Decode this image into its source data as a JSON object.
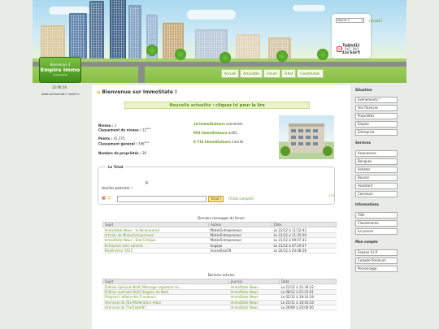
{
  "header": {
    "logo_line1": "Bienvenue à",
    "logo_line2": "Empire Immo",
    "logo_line3": "Indie Game",
    "nav": [
      "Accueil",
      "Actualités",
      "Forum",
      "Tchat",
      "Constitution"
    ],
    "world_select": "Monde 2",
    "avatar_alt": "[avatar]",
    "username": "Teddy911",
    "money": "414 648 €"
  },
  "clock": "12:06:14",
  "ad_slot": "data-ad-format=\"auto\">",
  "main": {
    "title": "Bienvenue sur ImmoState !",
    "news_label": "Nouvelle actualité",
    "news_action": " : cliquez ici pour la lire",
    "stats": {
      "niveau_label": "Niveau :",
      "niveau": "1",
      "classement_niveau_label": "Classement du niveau :",
      "classement_niveau": "12",
      "classement_niveau_sup": "ème",
      "points_label": "Points :",
      "points": "41 275",
      "classement_general_label": "Classement général :",
      "classement_general": "346",
      "classement_general_sup": "ème",
      "proprietes_label": "Nombre de propriétés :",
      "proprietes": "36"
    },
    "counts": [
      {
        "num": "14 ImmoStateurs",
        "text": " connectés"
      },
      {
        "num": "993 ImmoStateurs",
        "text": " actifs"
      },
      {
        "num": "8 716 ImmoStateurs",
        "text": " inscrits"
      }
    ],
    "tchat": {
      "title": "Le Tchat",
      "waiting": "Veuillez patienter !",
      "send": "Tchat !",
      "full": "[Tchat complet]",
      "expand": "[+]"
    },
    "forum": {
      "caption": "Derniers messages du forum",
      "headers": [
        "Sujet",
        "Auteur",
        "Date"
      ],
      "rows": [
        [
          "ImmoState News : la Renaissance",
          "MisterEntrepreneur",
          "Le 21/12 à 11:52:43"
        ],
        [
          "Articles de MisterEntrepreneur",
          "MisterEntrepreneur",
          "Le 21/12 à 11:35:59"
        ],
        [
          "ImmoState News : Etat Critique",
          "MisterEntrepreneur",
          "Le 21/12 à 09:57:33"
        ],
        [
          "Entreprise sans salariés",
          "Sugayo",
          "Le 21/12 à 07:19:57"
        ],
        [
          "Modérateur 2015",
          "marsellaix59",
          "Le 20/12 à 20:08:28"
        ]
      ]
    },
    "articles": {
      "caption": "Derniers articles",
      "headers": [
        "Sujet",
        "Journal",
        "Date"
      ],
      "rows": [
        [
          "[Edition Spéciale Noël] Message important du ...",
          "ImmoState News",
          "Le 21/12 à 11:34:12"
        ],
        [
          "[Edition spéciale Noël] Slogans de Noël",
          "ImmoState News",
          "Le 08/12 à 21:23:01"
        ],
        [
          "[People] L'affaire des Fraudeurs",
          "ImmoState News",
          "Le 02/12 à 18:14:16"
        ],
        [
          "Interview de l'Ex-Modérateur Adoo",
          "ImmoState News",
          "Le 25/11 à 16:43:24"
        ],
        [
          "Interview de TheTrader87",
          "ImmoState News",
          "Le 29/09 à 20:00:00"
        ]
      ]
    }
  },
  "sidebar": {
    "sections": [
      {
        "title": "Situation",
        "items": [
          "Evénements *",
          "Vos finances",
          "Propriétés",
          "Emploi",
          "Entreprise"
        ]
      },
      {
        "title": "Services",
        "items": [
          "Assurances",
          "Banques",
          "Acheter",
          "Bourse",
          "Assistant",
          "Concours"
        ]
      },
      {
        "title": "Informations",
        "items": [
          "Ville",
          "Classements",
          "La presse"
        ]
      },
      {
        "title": "Mon compte",
        "items": [
          "Espace V.I.P.",
          "Compte Premium",
          "Personnage"
        ]
      }
    ]
  },
  "colors": {
    "accent": "#6a9a1a",
    "banner": "#e8f4c6",
    "button": "#f6e58a"
  }
}
